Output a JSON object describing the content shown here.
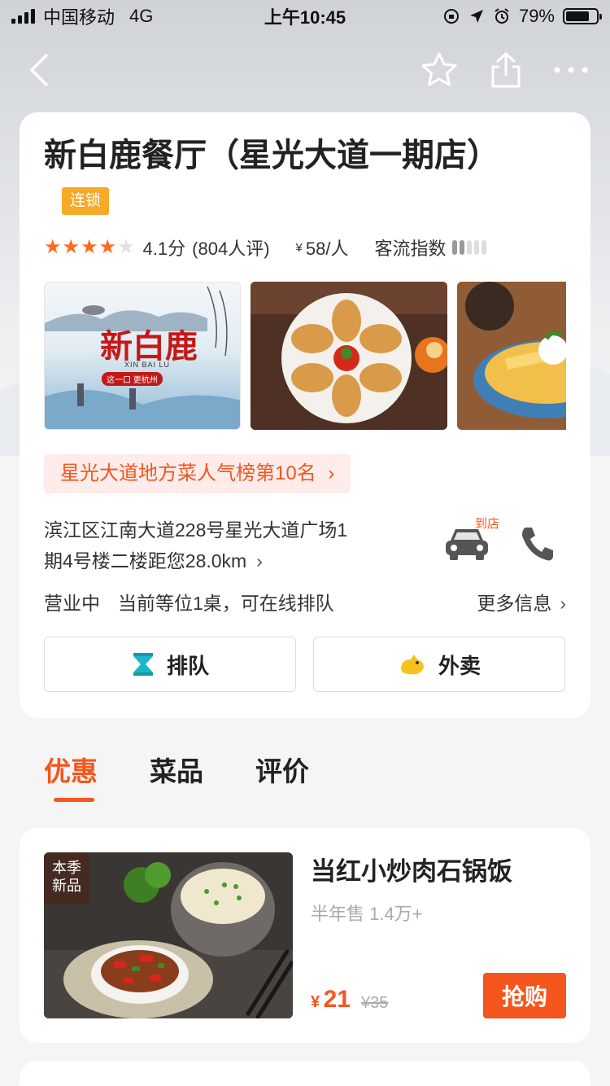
{
  "status_bar": {
    "carrier": "中国移动",
    "network": "4G",
    "time": "上午10:45",
    "battery_text": "79%",
    "battery_level": 0.79
  },
  "nav": {
    "back_icon": "chevron-left-icon",
    "favorite_icon": "star-outline-icon",
    "share_icon": "share-icon",
    "more_icon": "ellipsis-icon"
  },
  "shop": {
    "name": "新白鹿餐厅（星光大道一期店）",
    "chain_badge": "连锁",
    "rating_stars": 4,
    "rating_text": "4.1分",
    "review_count": "(804人评)",
    "price_symbol": "¥",
    "price_text": "58/人",
    "traffic_label": "客流指数",
    "traffic_level": 2,
    "logo_text": "新白鹿",
    "logo_pinyin": "XIN BAI LU",
    "logo_slogan": "这一口 更杭州",
    "rank_text": "星光大道地方菜人气榜第10名",
    "address_line1": "滨江区江南大道228号星光大道广场1",
    "address_line2": "期4号楼二楼距您28.0km",
    "to_shop_label": "到店",
    "open_status": "营业中",
    "queue_status": "当前等位1桌，可在线排队",
    "more_info": "更多信息",
    "queue_button": "排队",
    "delivery_button": "外卖"
  },
  "tabs": [
    {
      "label": "优惠",
      "active": true
    },
    {
      "label": "菜品",
      "active": false
    },
    {
      "label": "评价",
      "active": false
    }
  ],
  "deal": {
    "badge_line1": "本季",
    "badge_line2": "新品",
    "title": "当红小炒肉石锅饭",
    "sold": "半年售 1.4万+",
    "price_symbol": "¥",
    "price": "21",
    "original_price": "¥35",
    "buy_button": "抢购"
  },
  "colors": {
    "accent": "#f4561d",
    "star": "#ff6a1f",
    "badge": "#f7a928"
  }
}
